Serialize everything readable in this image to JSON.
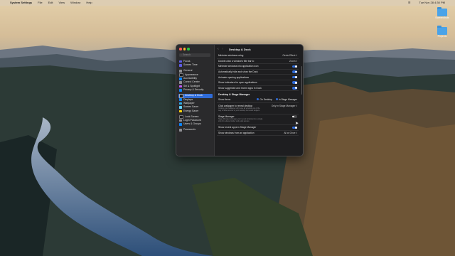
{
  "menubar": {
    "app": "System Settings",
    "menus": [
      "File",
      "Edit",
      "View",
      "Window",
      "Help"
    ],
    "clock": "Tue Nov 28  4:30 PM"
  },
  "desktop": {
    "icons": [
      {
        "label": "Screenshots"
      },
      {
        "label": "Projects"
      }
    ]
  },
  "window": {
    "title": "Desktop & Dock",
    "search_placeholder": "Search",
    "sidebar": [
      {
        "label": "Focus",
        "color": "#5e5ce6"
      },
      {
        "label": "Screen Time",
        "color": "#5e5ce6"
      },
      {
        "label": "General",
        "color": "#8e8e93"
      },
      {
        "label": "Appearance",
        "color": "#1c1c1e"
      },
      {
        "label": "Accessibility",
        "color": "#0a84ff"
      },
      {
        "label": "Control Center",
        "color": "#8e8e93"
      },
      {
        "label": "Siri & Spotlight",
        "color": "#bf5af2"
      },
      {
        "label": "Privacy & Security",
        "color": "#0a84ff"
      },
      {
        "label": "Desktop & Dock",
        "color": "#1c1c1e"
      },
      {
        "label": "Displays",
        "color": "#0a84ff"
      },
      {
        "label": "Wallpaper",
        "color": "#32ade6"
      },
      {
        "label": "Screen Saver",
        "color": "#64d2ff"
      },
      {
        "label": "Energy Saver",
        "color": "#ffd60a"
      },
      {
        "label": "Lock Screen",
        "color": "#1c1c1e"
      },
      {
        "label": "Login Password",
        "color": "#8e8e93"
      },
      {
        "label": "Users & Groups",
        "color": "#0a84ff"
      },
      {
        "label": "Passwords",
        "color": "#8e8e93"
      }
    ],
    "rows1": [
      {
        "label": "Minimize windows using",
        "value": "Genie Effect ◊",
        "toggle": null
      },
      {
        "label": "Double-click a window's title bar to",
        "value": "Zoom ◊",
        "toggle": null
      },
      {
        "label": "Minimize windows into application icon",
        "value": "",
        "toggle": true
      },
      {
        "label": "Automatically hide and show the Dock",
        "value": "",
        "toggle": true
      },
      {
        "label": "Animate opening applications",
        "value": "",
        "toggle": true
      },
      {
        "label": "Show indicators for open applications",
        "value": "",
        "toggle": true
      },
      {
        "label": "Show suggested and recent apps in Dock",
        "value": "",
        "toggle": true
      }
    ],
    "section": "Desktop & Stage Manager",
    "show_items": {
      "label": "Show Items",
      "opt1": "On Desktop",
      "opt2": "In Stage Manager"
    },
    "click_wallpaper": {
      "label": "Click wallpaper to reveal desktop",
      "sub": "Clicking your wallpaper will move all windows out of the way to allow access to your desktop items and widgets.",
      "value": "Only in Stage Manager ◊"
    },
    "stage_manager": {
      "label": "Stage Manager",
      "sub": "Stage Manager arranges your recent windows into a single strip for reduced clutter and quick access.",
      "toggle": false
    },
    "rows2": [
      {
        "label": "Show recent apps in Stage Manager",
        "value": "",
        "toggle": true
      },
      {
        "label": "Show windows from an application",
        "value": "All at Once ◊",
        "toggle": null
      }
    ]
  }
}
